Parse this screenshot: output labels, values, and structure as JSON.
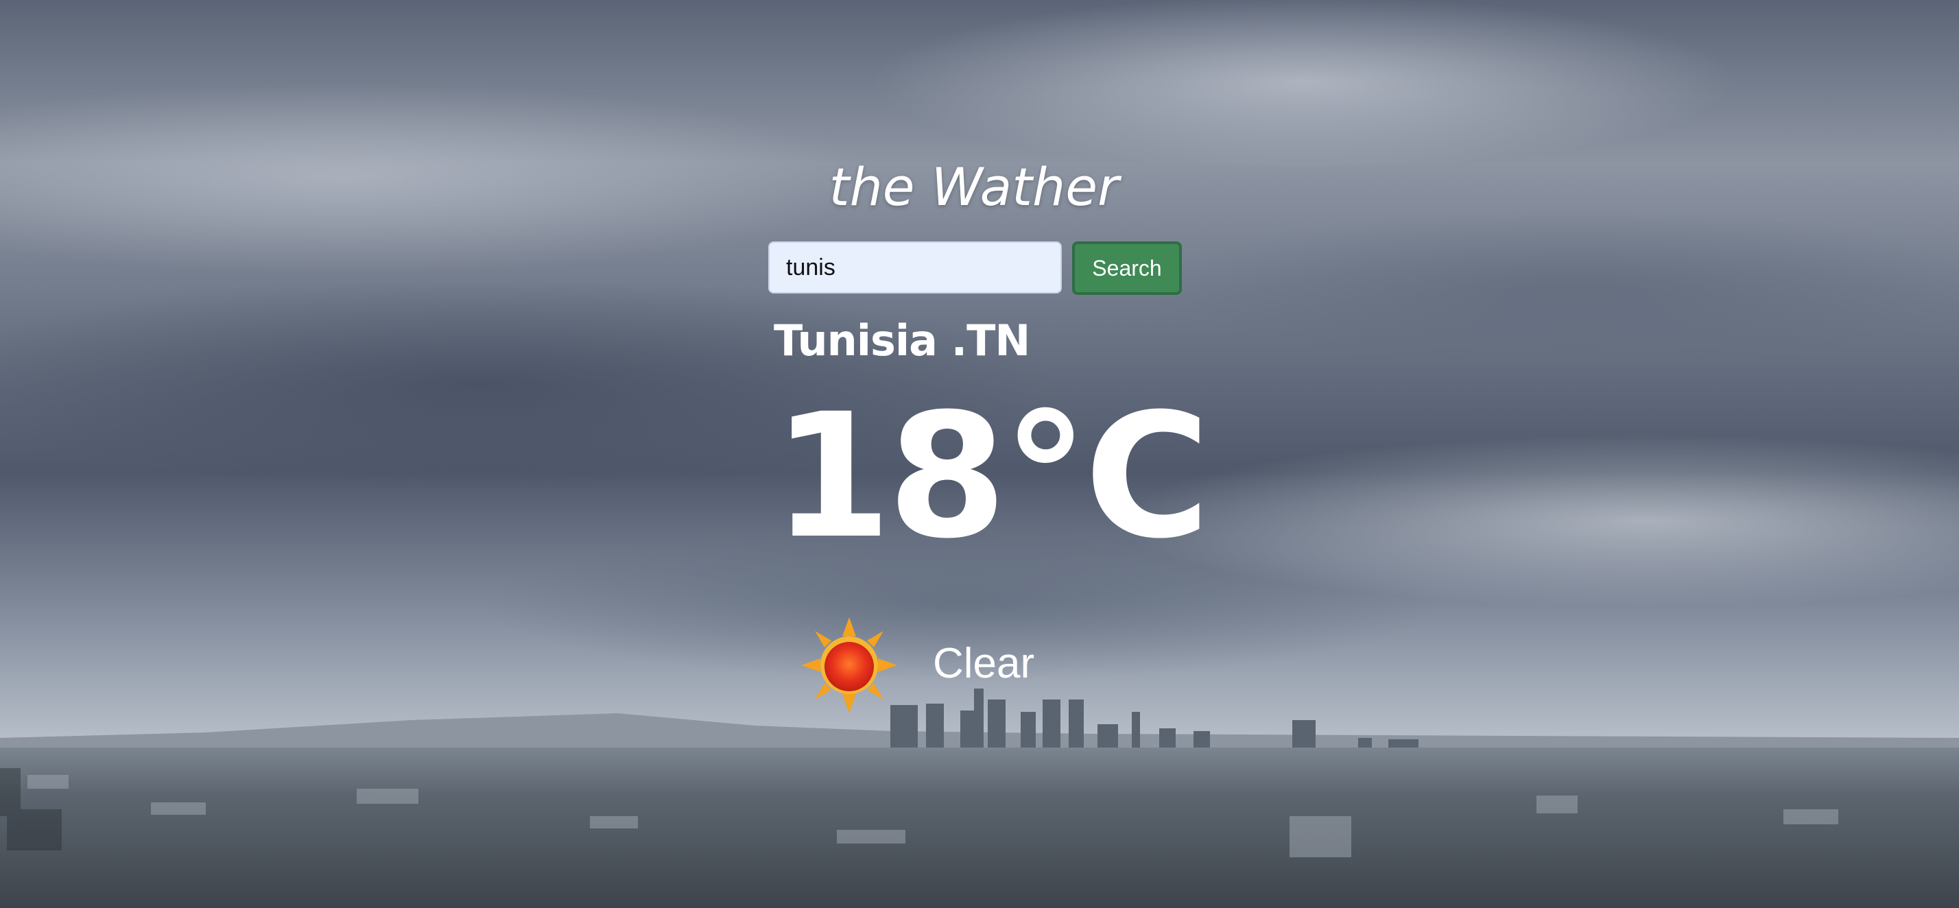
{
  "app": {
    "title": "the Wather"
  },
  "search": {
    "value": "tunis",
    "placeholder": "",
    "button_label": "Search"
  },
  "weather": {
    "location": "Tunisia .TN",
    "temperature": "18°C",
    "condition": "Clear",
    "icon": "sun-icon"
  },
  "colors": {
    "search_button_bg": "#3f8a55",
    "search_input_bg": "#e8effd",
    "text": "#ffffff"
  }
}
